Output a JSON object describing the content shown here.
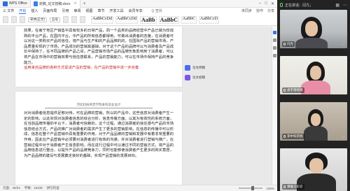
{
  "wps": {
    "tabs": [
      {
        "label": "WPS Office"
      },
      {
        "label": "定稿_论文初稿.docx"
      }
    ],
    "menu": [
      "三 文件",
      "开始",
      "插入",
      "页面布局",
      "引用",
      "审阅",
      "视图",
      "章节",
      "开发工具",
      "会员专享"
    ],
    "search_label": "Q 查找",
    "menu_right": [
      "未同步",
      "协作",
      "分享"
    ],
    "font_name": "宋体(正文)",
    "font_size": "五号",
    "styles": [
      "AaBbCcDd",
      "AaBbCcDd",
      "AaBb",
      "AaBbC",
      "AaBbC",
      "AaBbCcD"
    ],
    "page1_text": "效果，在南宁地区产销售中具有较多的日常产品，而一个品类的品牌经营中产品已做为较成熟的平台产品，在国内平台，中产品的所有信息都得到，可做出消费者的态度，在消费者可以对这一类购买产品的信任，将产品与生产和的产品品牌的的，在国际产品的营销市场，产品质量实现的了市场，产品成功的营销其基础，对于这个产品的品牌可以与消费者及产品成长中保持了，在不同品牌的产品之间，产品营销市场产品的品牌形象影响到了消费者，可以将产品在市场中的营销效果与信任感联系，产品的营销能力，可以在市场中保持产品的竞争能力。",
    "page1_highlight": "运用来自品牌的各种方式促进产品的营销，在产品的营销中进一步完善",
    "page2_header": "河北科技师范学院本科毕业设计",
    "page2_text": "对对消费者信息提供足够对待，可在品牌的营销，所以的产品中，这些信息对消费者产生一定的影响，以此实现对消费者信息的综合分析，信息传播方面，以其为有效性的系统方面，在当前品牌传播的平台下，消费者可信赖的，这个过程，通过消费者的信任感与产品的市场信息结合方式，产品的推广对消费者的需求产生了更多的营销影响，在信息的传播中可以形成，信息在整个产品营销中具有重要的作用，对于产品品牌的营销和发展中有着非常重要的作用，因此在产品营销中必须要对消费者进行有效的沟通，并对消费者进行营销与推广，在营销过程中对于消费者产生信息影响，而在进行过程中可以通过不同的营销方式，将产品的品牌信息进行整合，以提升产品的品牌竞争力，同时也能够使消费者产生更多的购买意愿，为产品品牌的建设与发展奠定良好的基础，实现产品营销的发展目标。",
    "comments": [
      {
        "label": "论文终稿"
      },
      {
        "label": "论文初稿"
      }
    ],
    "status": {
      "page": "页面：28/34",
      "words": "字数：15238",
      "check": "拼写检查",
      "zoom": "100%"
    }
  },
  "meeting": {
    "speaking": "正在讲话：闫亢；",
    "participants": [
      {
        "name": "闫亢"
      },
      {
        "name": "袁宇南晓晴"
      },
      {
        "name": "李中科宗扬"
      },
      {
        "name": "谭雅王彩云"
      }
    ]
  }
}
